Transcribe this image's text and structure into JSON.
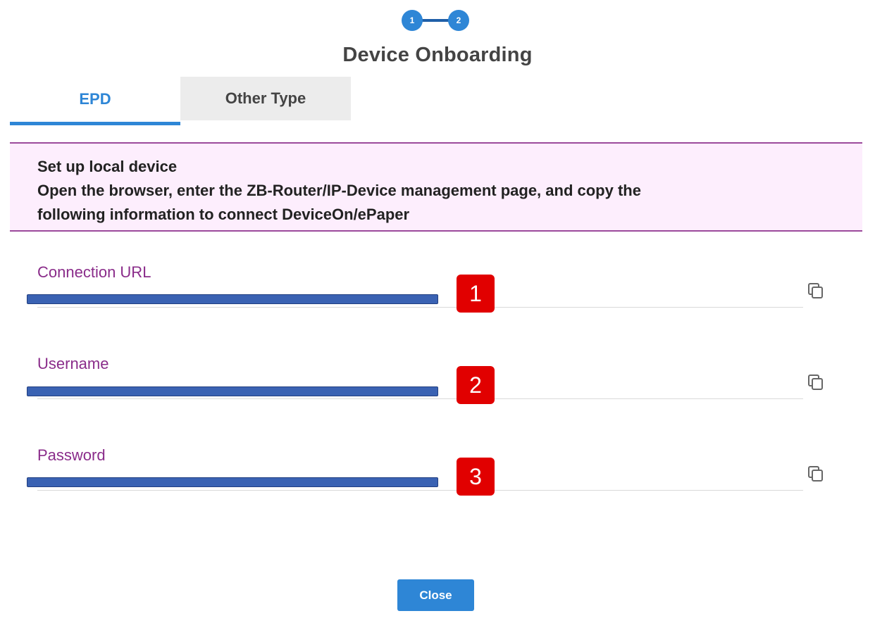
{
  "stepper": {
    "steps": [
      "1",
      "2"
    ],
    "current": 2
  },
  "dialog": {
    "title": "Device Onboarding"
  },
  "tabs": [
    {
      "label": "EPD",
      "active": true
    },
    {
      "label": "Other Type",
      "active": false
    }
  ],
  "banner": {
    "heading": "Set up local device",
    "line1": "Open the browser, enter the ZB-Router/IP-Device management page, and copy the",
    "line2": "following information to connect DeviceOn/ePaper"
  },
  "fields": [
    {
      "label": "Connection URL",
      "icon": "copy-icon",
      "marker": "1"
    },
    {
      "label": "Username",
      "icon": "copy-icon",
      "marker": "2"
    },
    {
      "label": "Password",
      "icon": "copy-icon",
      "marker": "3"
    }
  ],
  "footer": {
    "close_label": "Close"
  },
  "colors": {
    "accent": "#2e86d6",
    "label": "#8a2c8a",
    "banner_bg": "#fdeefd",
    "marker": "#e10000"
  }
}
